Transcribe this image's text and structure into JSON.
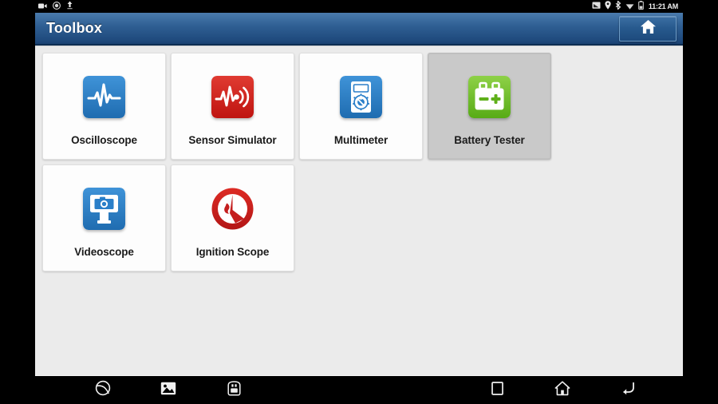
{
  "status_bar": {
    "left_icons": [
      {
        "name": "video-camera-icon",
        "label": "video recorder"
      },
      {
        "name": "screen-record-icon",
        "label": "screen record"
      },
      {
        "name": "upload-arrow-icon",
        "label": "upload"
      }
    ],
    "right_icons": [
      {
        "name": "screen-cast-icon",
        "label": "cast"
      },
      {
        "name": "location-pin-icon",
        "label": "location"
      },
      {
        "name": "bluetooth-icon",
        "label": "bluetooth"
      },
      {
        "name": "wifi-icon",
        "label": "wifi"
      },
      {
        "name": "battery-icon",
        "label": "battery"
      }
    ],
    "time": "11:21 AM"
  },
  "title_bar": {
    "title": "Toolbox",
    "home_button_label": "Home",
    "accent_color": "#2f5f93"
  },
  "tools": [
    {
      "id": "oscilloscope",
      "label": "Oscilloscope",
      "icon": "oscilloscope-icon",
      "icon_color": "#2a7fc9",
      "selected": false
    },
    {
      "id": "sensor-simulator",
      "label": "Sensor Simulator",
      "icon": "sensor-simulator-icon",
      "icon_color": "#d0211c",
      "selected": false
    },
    {
      "id": "multimeter",
      "label": "Multimeter",
      "icon": "multimeter-icon",
      "icon_color": "#2a7fc9",
      "selected": false
    },
    {
      "id": "battery-tester",
      "label": "Battery Tester",
      "icon": "battery-tester-icon",
      "icon_color": "#6cbe2a",
      "selected": true
    },
    {
      "id": "videoscope",
      "label": "Videoscope",
      "icon": "videoscope-icon",
      "icon_color": "#2a7fc9",
      "selected": false
    },
    {
      "id": "ignition-scope",
      "label": "Ignition Scope",
      "icon": "ignition-scope-icon",
      "icon_color": "#cc1f1f",
      "selected": false
    }
  ],
  "nav_bar": {
    "left": [
      {
        "name": "browser-icon",
        "label": "Browser"
      },
      {
        "name": "gallery-icon",
        "label": "Gallery"
      },
      {
        "name": "vci-icon",
        "label": "VCI"
      }
    ],
    "right": [
      {
        "name": "recents-square-icon",
        "label": "Recent apps"
      },
      {
        "name": "home-house-icon",
        "label": "Home"
      },
      {
        "name": "back-arrow-icon",
        "label": "Back"
      }
    ]
  },
  "colors": {
    "page_background": "#ebebeb",
    "tile_background": "#fdfdfd",
    "tile_selected_background": "#c9c9c9",
    "title_bar_blue": "#2f5f93",
    "bezel_black": "#000000"
  }
}
